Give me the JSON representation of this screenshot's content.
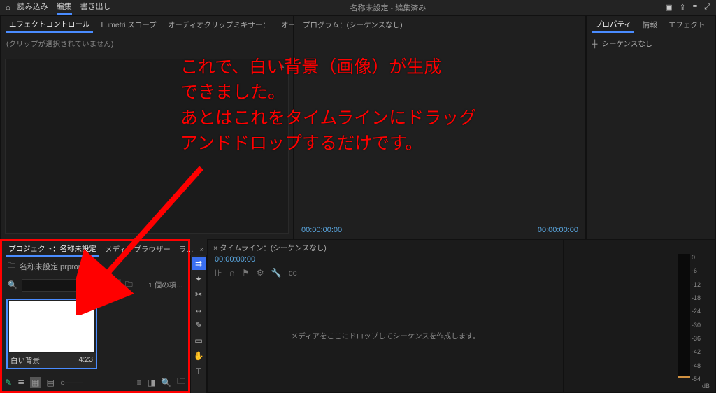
{
  "topbar": {
    "menus": [
      "読み込み",
      "編集",
      "書き出し"
    ],
    "active_menu": "編集",
    "title": "名称未設定 - 編集済み"
  },
  "effect_panel": {
    "tabs": [
      "エフェクトコントロール",
      "Lumetri スコープ",
      "オーディオクリップミキサー：",
      "オーディオト"
    ],
    "active_tab": "エフェクトコントロール",
    "body_text": "(クリップが選択されていません)"
  },
  "program_panel": {
    "label": "プログラム：(シーケンスなし)",
    "tc_left": "00:00:00:00",
    "tc_right": "00:00:00:00"
  },
  "properties_panel": {
    "tabs": [
      "プロパティ",
      "情報",
      "エフェクト"
    ],
    "active_tab": "プロパティ",
    "body": "シーケンスなし"
  },
  "project_panel": {
    "tabs": [
      "プロジェクト：名称未設定",
      "メディアブラウザー",
      "ラ…"
    ],
    "active_tab": "プロジェクト：名称未設定",
    "project_file": "名称未設定.prproj",
    "item_count": "1 個の項...",
    "clip": {
      "name": "白い背景",
      "duration": "4:23"
    }
  },
  "timeline_panel": {
    "label": "× タイムライン：(シーケンスなし)",
    "tc": "00:00:00:00",
    "drop_hint": "メディアをここにドロップしてシーケンスを作成します。"
  },
  "audiometer": {
    "scale": [
      "0",
      "-6",
      "-12",
      "-18",
      "-24",
      "-30",
      "-36",
      "-42",
      "-48",
      "-54"
    ],
    "unit": "dB"
  },
  "annotation": {
    "line1": "これで、白い背景（画像）が生成",
    "line2": "できました。",
    "line3": "あとはこれをタイムラインにドラッグ",
    "line4": "アンドドロップするだけです。"
  }
}
